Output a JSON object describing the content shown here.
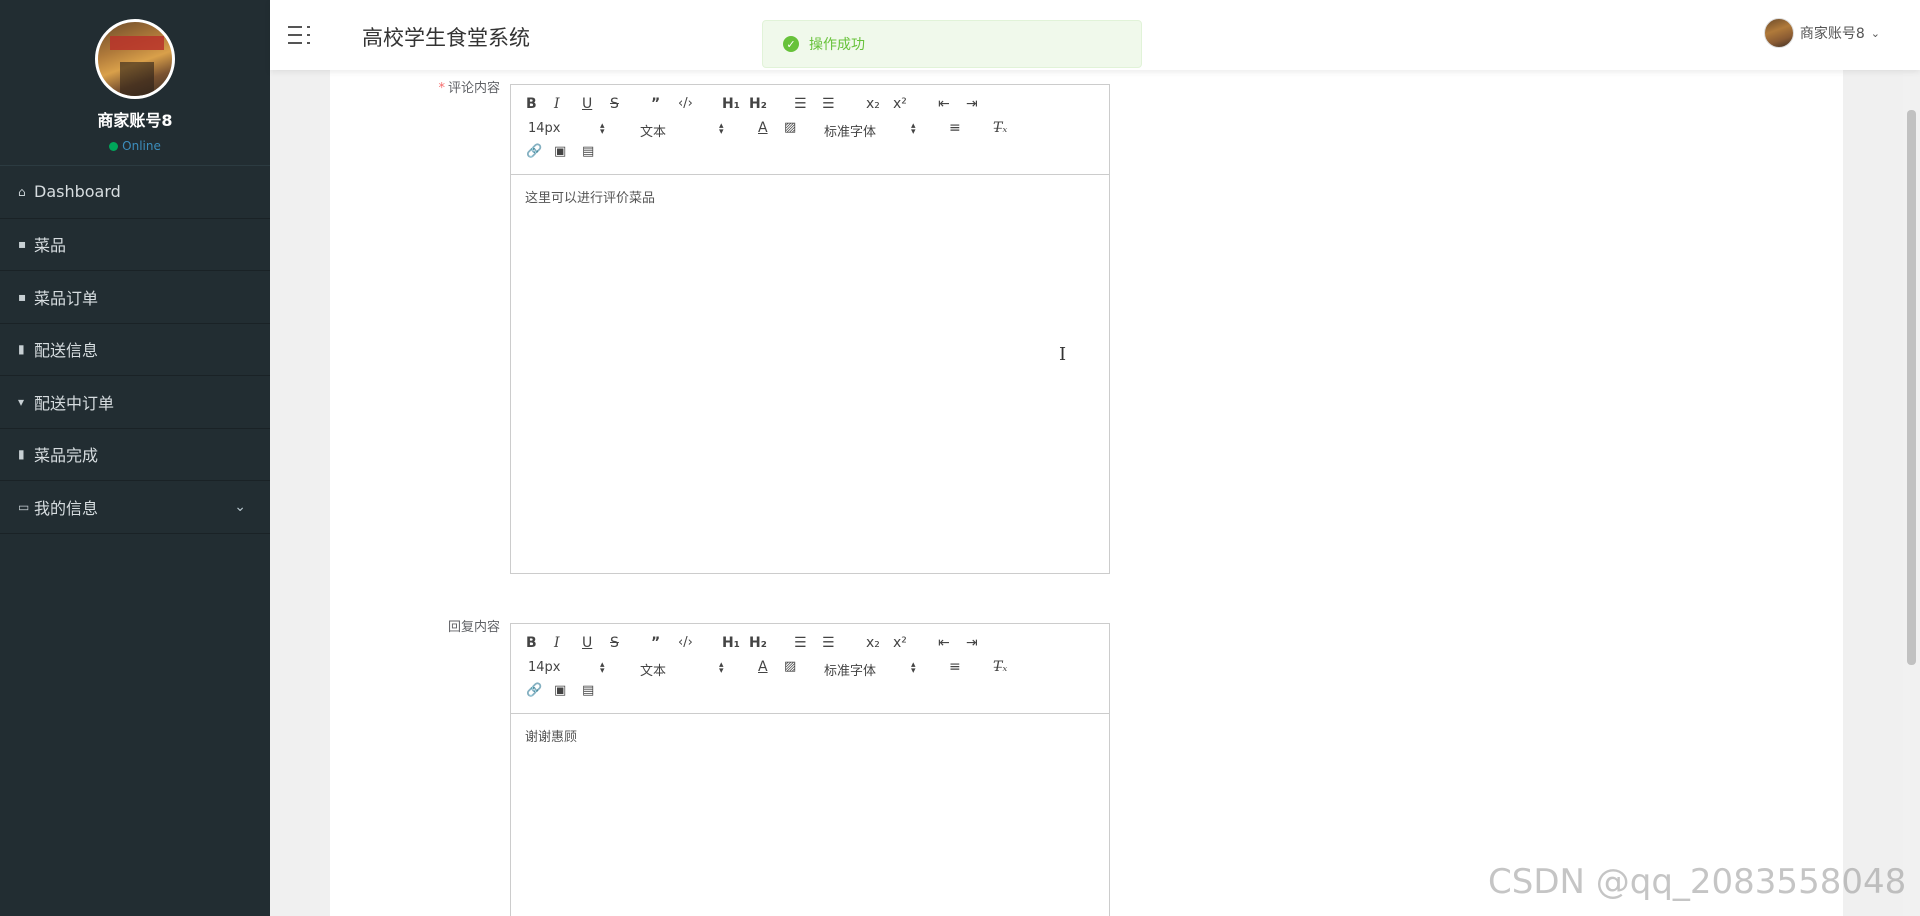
{
  "app": {
    "title": "高校学生食堂系统"
  },
  "sidebar": {
    "profile": {
      "name": "商家账号8",
      "status": "Online"
    },
    "items": [
      {
        "icon": "home-icon",
        "glyph": "⌂",
        "label": "Dashboard"
      },
      {
        "icon": "grid-icon",
        "glyph": "▪",
        "label": "菜品"
      },
      {
        "icon": "grid-icon",
        "glyph": "▪",
        "label": "菜品订单"
      },
      {
        "icon": "clipboard-icon",
        "glyph": "▮",
        "label": "配送信息"
      },
      {
        "icon": "cup-icon",
        "glyph": "▾",
        "label": "配送中订单"
      },
      {
        "icon": "bar-chart-icon",
        "glyph": "▮",
        "label": "菜品完成"
      },
      {
        "icon": "id-card-icon",
        "glyph": "▭",
        "label": "我的信息",
        "expandable": true
      }
    ]
  },
  "header": {
    "user": "商家账号8"
  },
  "toast": {
    "message": "操作成功",
    "type": "success",
    "color": "#67c23a"
  },
  "form": {
    "comment": {
      "label": "评论内容",
      "required": true,
      "content": "这里可以进行评价菜品"
    },
    "reply": {
      "label": "回复内容",
      "required": false,
      "content": "谢谢惠顾"
    }
  },
  "editor_toolbar": {
    "font_size": "14px",
    "header_select": "文本",
    "font_family": "标准字体",
    "buttons": [
      "bold",
      "italic",
      "underline",
      "strike",
      "blockquote",
      "code-block",
      "h1",
      "h2",
      "ordered-list",
      "bullet-list",
      "subscript",
      "superscript",
      "outdent",
      "indent",
      "color",
      "background",
      "align",
      "clean",
      "link",
      "image",
      "video"
    ]
  },
  "watermark": "CSDN @qq_2083558048",
  "colors": {
    "sidebar": "#222d32",
    "accent": "#3c8dbc",
    "online": "#00a65a",
    "success": "#67c23a"
  }
}
